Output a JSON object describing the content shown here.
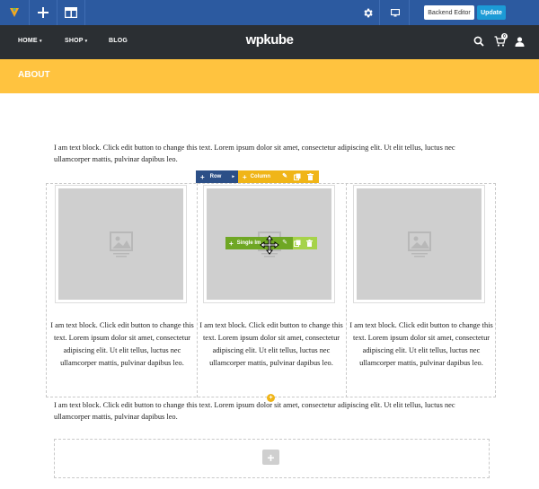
{
  "editor": {
    "backend_editor_label": "Backend Editor",
    "update_label": "Update",
    "accent_color": "#2c5aa0",
    "update_color": "#1c9bd6"
  },
  "nav": {
    "items": [
      {
        "label": "HOME",
        "caret": "▾"
      },
      {
        "label": "SHOP",
        "caret": "▾"
      },
      {
        "label": "BLOG"
      }
    ],
    "logo": "wpkube",
    "cart_count": "0"
  },
  "page": {
    "title": "ABOUT",
    "title_bar_color": "#ffc33f"
  },
  "content": {
    "top_text": "I am text block. Click edit button to change this text. Lorem ipsum dolor sit amet, consectetur adipiscing elit. Ut elit tellus, luctus nec ullamcorper mattis, pulvinar dapibus leo.",
    "bottom_text": "I am text block. Click edit button to change this text. Lorem ipsum dolor sit amet, consectetur adipiscing elit. Ut elit tellus, luctus nec ullamcorper mattis, pulvinar dapibus leo.",
    "columns": [
      {
        "text": "I am text block. Click edit button to change this text. Lorem ipsum dolor sit amet, consectetur adipiscing elit. Ut elit tellus, luctus nec ullamcorper mattis, pulvinar dapibus leo."
      },
      {
        "text": "I am text block. Click edit button to change this text. Lorem ipsum dolor sit amet, consectetur adipiscing elit. Ut elit tellus, luctus nec ullamcorper mattis, pulvinar dapibus leo."
      },
      {
        "text": "I am text block. Click edit button to change this text. Lorem ipsum dolor sit amet, consectetur adipiscing elit. Ut elit tellus, luctus nec ullamcorper mattis, pulvinar dapibus leo."
      }
    ]
  },
  "controls": {
    "row_label": "Row",
    "column_label": "Column",
    "element_label": "Single Im",
    "add_symbol": "+",
    "row_color": "#2c4f87",
    "column_color": "#f0b518",
    "element_color": "#6fa724"
  }
}
